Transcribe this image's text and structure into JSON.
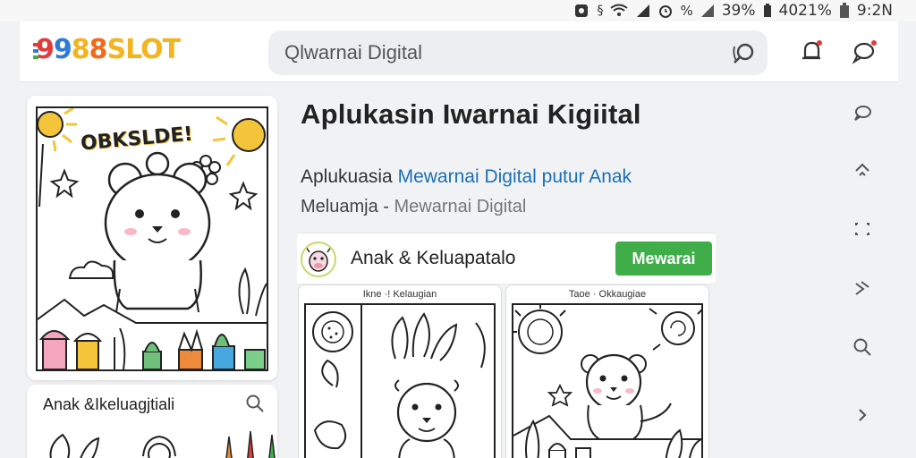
{
  "status_bar": {
    "battery": "39%",
    "data": "4021%",
    "time": "9:2N"
  },
  "header": {
    "logo": {
      "part1": "9",
      "part2": "9",
      "part3": "8",
      "part4": "8",
      "part5": "SLOT"
    },
    "search_placeholder": "Qlwarnai Digital"
  },
  "hero": {
    "heading": "OBKSLDE!"
  },
  "left_list": {
    "title": "Anak &Ikeluagjtiali"
  },
  "main": {
    "title": "Aplukasin Iwarnai Kigiital",
    "sub1_prefix": "Aplukuasia ",
    "sub1_accent": "Mewarnai Digital",
    "sub1_suffix": " putur Anak",
    "sub2_prefix": "Meluamja - ",
    "sub2_muted": "Mewarnai Digital"
  },
  "author": {
    "name": "Anak & Keluapatalo",
    "cta_label": "Mewarai"
  },
  "pages": [
    {
      "caption": "Ikne ·! Kelaugian"
    },
    {
      "caption": "Taoe · Okkaugiae"
    }
  ],
  "rail_icons": [
    "chat-icon",
    "up-icon",
    "expand-icon",
    "share-icon",
    "search-icon",
    "chevron-right-icon"
  ],
  "colors": {
    "accent": "#1b6fb5",
    "cta": "#3fae49",
    "logo_blue": "#2e7bd6",
    "logo_yellow": "#f2b41f",
    "logo_red": "#e23b3b"
  }
}
